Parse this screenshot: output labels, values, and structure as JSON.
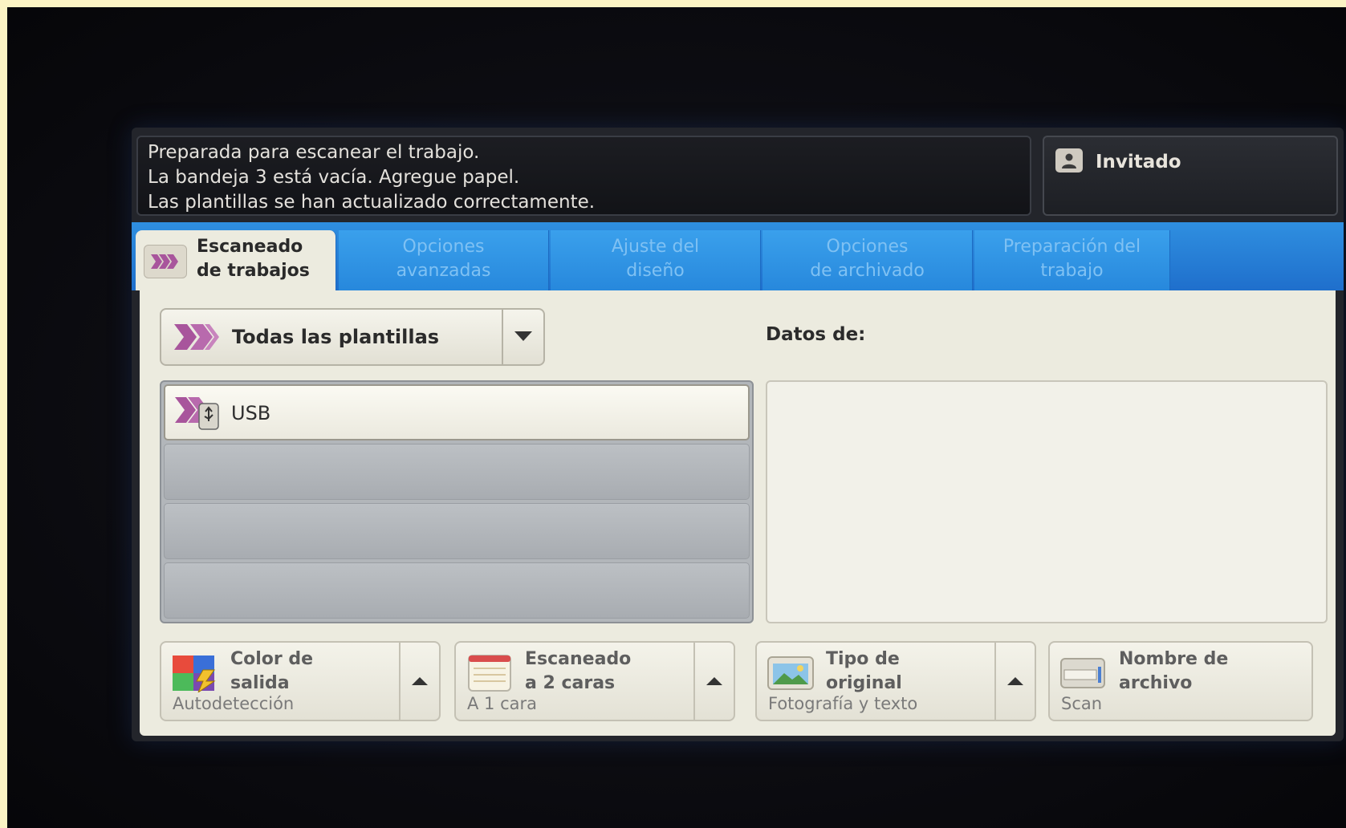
{
  "status": {
    "lines": [
      "Preparada para escanear el trabajo.",
      "La bandeja 3 está vacía. Agregue papel.",
      "Las plantillas se han actualizado correctamente."
    ]
  },
  "user": {
    "label": "Invitado"
  },
  "tabs": [
    {
      "line1": "Escaneado",
      "line2": "de trabajos"
    },
    {
      "line1": "Opciones",
      "line2": "avanzadas"
    },
    {
      "line1": "Ajuste del",
      "line2": "diseño"
    },
    {
      "line1": "Opciones",
      "line2": "de archivado"
    },
    {
      "line1": "Preparación del",
      "line2": "trabajo"
    }
  ],
  "templates": {
    "filter_label": "Todas las plantillas",
    "items": [
      "USB"
    ]
  },
  "details": {
    "label": "Datos de:"
  },
  "features": [
    {
      "title1": "Color de",
      "title2": "salida",
      "value": "Autodetección"
    },
    {
      "title1": "Escaneado",
      "title2": "a 2 caras",
      "value": "A 1 cara"
    },
    {
      "title1": "Tipo de",
      "title2": "original",
      "value": "Fotografía y texto"
    },
    {
      "title1": "Nombre de",
      "title2": "archivo",
      "value": "Scan"
    }
  ],
  "colors": {
    "tab_blue": "#2788dc",
    "panel_bg": "#ecebdf",
    "template_icon": "#a8559c"
  }
}
